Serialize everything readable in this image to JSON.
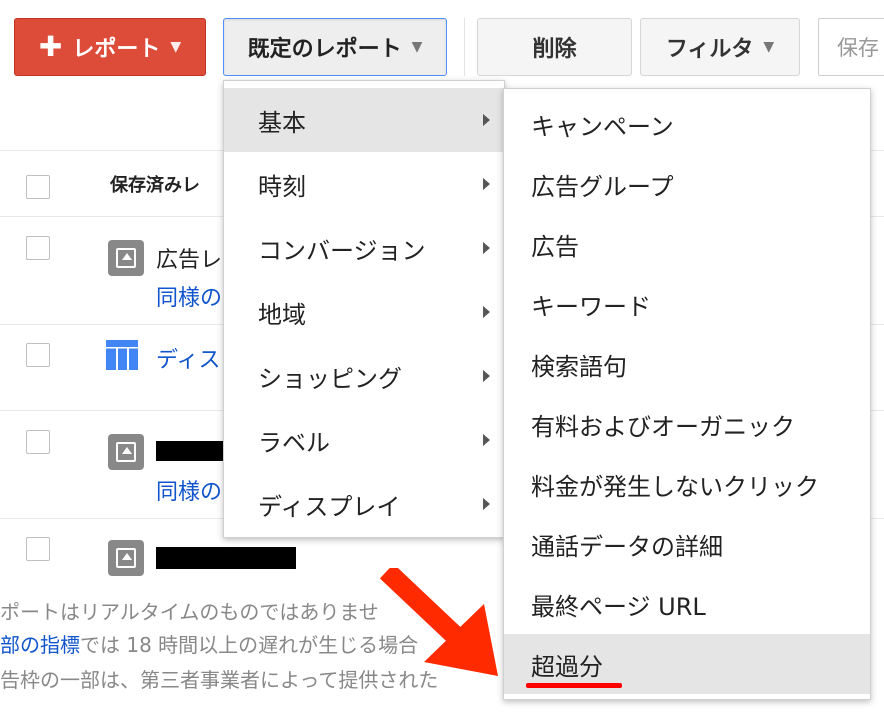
{
  "toolbar": {
    "report_label": "レポート",
    "default_reports_label": "既定のレポート",
    "delete_label": "削除",
    "filter_label": "フィルタ",
    "save_placeholder": "保存"
  },
  "table": {
    "header_saved_reports": "保存済みレ",
    "rows": [
      {
        "title": "広告レ",
        "link": "同様の"
      },
      {
        "title": "ディス"
      },
      {
        "link": "同様の"
      },
      {}
    ]
  },
  "footer": {
    "line1": "ポートはリアルタイムのものではありませ",
    "line2_link": "部の指標",
    "line2_text": "では 18 時間以上の遅れが生じる場合",
    "line3": "告枠の一部は、第三者事業者によって提供された"
  },
  "menu_categories": {
    "items": [
      {
        "label": "基本"
      },
      {
        "label": "時刻"
      },
      {
        "label": "コンバージョン"
      },
      {
        "label": "地域"
      },
      {
        "label": "ショッピング"
      },
      {
        "label": "ラベル"
      },
      {
        "label": "ディスプレイ"
      }
    ]
  },
  "menu_basic": {
    "items": [
      {
        "label": "キャンペーン"
      },
      {
        "label": "広告グループ"
      },
      {
        "label": "広告"
      },
      {
        "label": "キーワード"
      },
      {
        "label": "検索語句"
      },
      {
        "label": "有料およびオーガニック"
      },
      {
        "label": "料金が発生しないクリック"
      },
      {
        "label": "通話データの詳細"
      },
      {
        "label": "最終ページ URL"
      },
      {
        "label": "超過分"
      }
    ]
  },
  "colors": {
    "report_button": "#dd4b39",
    "link": "#1155cc",
    "annotation_red": "#ff0000"
  }
}
